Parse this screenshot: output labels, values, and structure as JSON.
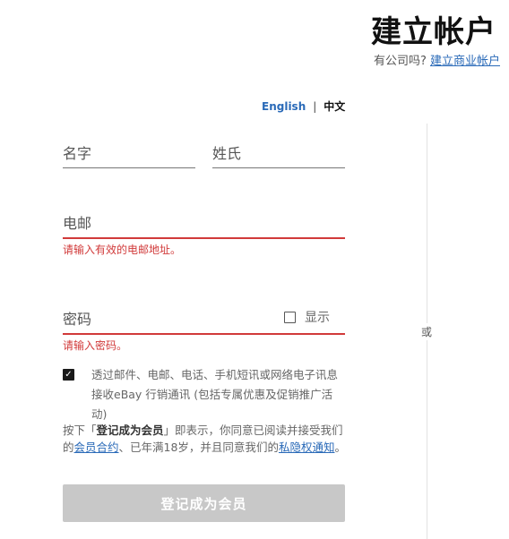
{
  "header": {
    "title": "建立帐户",
    "business_prompt": "有公司吗?",
    "business_link": "建立商业帐户"
  },
  "language": {
    "english": "English",
    "separator": "|",
    "chinese": "中文"
  },
  "form": {
    "first_name_placeholder": "名字",
    "last_name_placeholder": "姓氏",
    "email_placeholder": "电邮",
    "email_error": "请输入有效的电邮地址。",
    "password_placeholder": "密码",
    "password_error": "请输入密码。",
    "show_password_label": "显示",
    "consent_checked": true,
    "consent_text": "透过邮件、电邮、电话、手机短讯或网络电子讯息接收eBay 行销通讯 (包括专属优惠及促销推广活动)",
    "terms_prefix": "按下「",
    "terms_bold": "登记成为会员",
    "terms_mid1": "」即表示，你同意已阅读并接受我们的",
    "terms_link1": "会员合约",
    "terms_mid2": "、已年满18岁，并且同意我们的",
    "terms_link2": "私隐权通知",
    "terms_suffix": "。",
    "submit_label": "登记成为会员"
  },
  "divider_label": "或"
}
